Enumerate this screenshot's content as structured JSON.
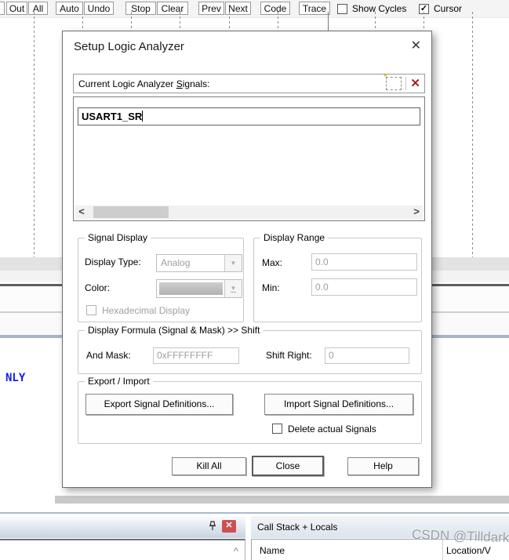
{
  "toolbar": {
    "buttons": [
      "Out",
      "All",
      "Auto",
      "Undo",
      "Stop",
      "Clear",
      "Prev",
      "Next",
      "Code",
      "Trace"
    ],
    "show_cycles_label": "Show Cycles",
    "cursor_label": "Cursor",
    "show_cycles_checked": false,
    "cursor_checked": true
  },
  "icons": {
    "close_glyph": "✕",
    "delete_glyph": "✕",
    "spark_glyph": "*",
    "check_glyph": "✓",
    "scroll_left_glyph": "<",
    "scroll_right_glyph": ">",
    "dropdown_arrow_glyph": "▼",
    "up_arrow_glyph": "^"
  },
  "dialog": {
    "title": "Setup Logic Analyzer",
    "signals_bar": {
      "label_pre": "Current Logic Analyzer ",
      "label_accel": "S",
      "label_post": "ignals:"
    },
    "signal_edit_value": "USART1_SR",
    "signal_display": {
      "label": "Signal Display",
      "display_type_label": "Display Type:",
      "display_type_value": "Analog",
      "color_label": "Color:",
      "hex_label": "Hexadecimal Display"
    },
    "display_range": {
      "label": "Display Range",
      "max_label": "Max:",
      "max_value": "0.0",
      "min_label": "Min:",
      "min_value": "0.0"
    },
    "display_formula": {
      "label": "Display Formula (Signal & Mask) >> Shift",
      "and_mask_label": "And Mask:",
      "and_mask_value": "0xFFFFFFFF",
      "shift_right_label": "Shift Right:",
      "shift_right_value": "0"
    },
    "export_import": {
      "label": "Export / Import",
      "export_button": "Export Signal Definitions...",
      "import_button": "Import Signal Definitions...",
      "delete_checkbox_label": "Delete actual Signals"
    },
    "footer": {
      "kill_all": "Kill All",
      "close": "Close",
      "help": "Help"
    }
  },
  "background": {
    "code_text": "NLY"
  },
  "bottom": {
    "call_stack_title": "Call Stack + Locals",
    "name_header": "Name",
    "location_header": "Location/V",
    "watermark": "CSDN @Tilldark"
  }
}
